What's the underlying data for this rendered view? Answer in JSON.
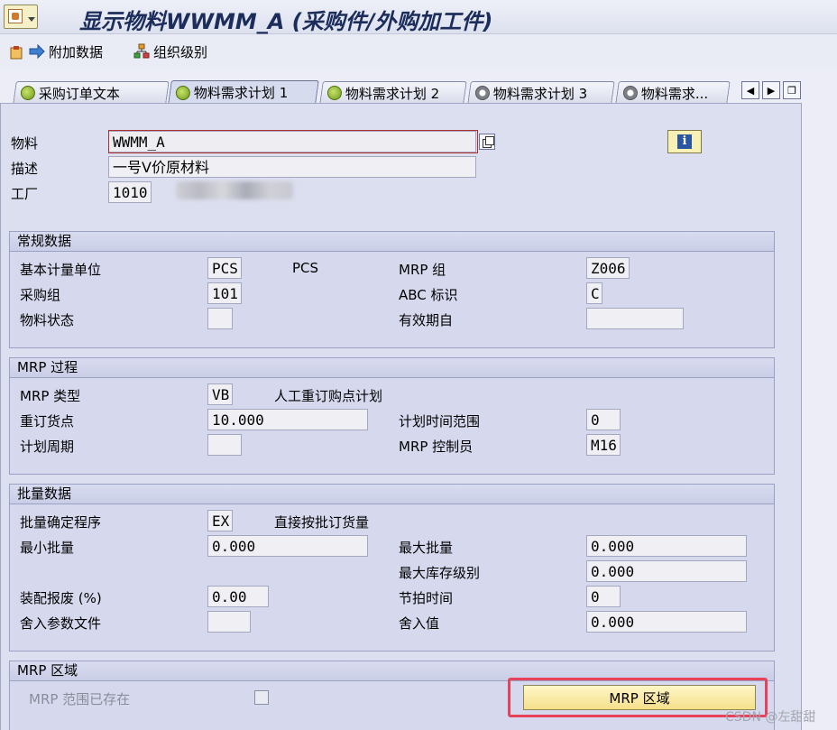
{
  "window": {
    "title": "显示物料WWMM_A (采购件/外购加工件)"
  },
  "toolbar": {
    "additional_data": "附加数据",
    "org_levels": "组织级别"
  },
  "tabs": [
    "采购订单文本",
    "物料需求计划 1",
    "物料需求计划 2",
    "物料需求计划 3",
    "物料需求..."
  ],
  "header": {
    "material_label": "物料",
    "material_value": "WWMM_A",
    "desc_label": "描述",
    "desc_value": "一号V价原材料",
    "plant_label": "工厂",
    "plant_value": "1010"
  },
  "general": {
    "title": "常规数据",
    "base_uom_label": "基本计量单位",
    "base_uom_value": "PCS",
    "base_uom_text": "PCS",
    "mrp_group_label": "MRP 组",
    "mrp_group_value": "Z006",
    "purch_group_label": "采购组",
    "purch_group_value": "101",
    "abc_label": "ABC 标识",
    "abc_value": "C",
    "status_label": "物料状态",
    "status_value": "",
    "valid_from_label": "有效期自",
    "valid_from_value": ""
  },
  "mrp_proc": {
    "title": "MRP 过程",
    "type_label": "MRP 类型",
    "type_value": "VB",
    "type_text": "人工重订购点计划",
    "reorder_label": "重订货点",
    "reorder_value": "10.000",
    "horizon_label": "计划时间范围",
    "horizon_value": "0",
    "cycle_label": "计划周期",
    "cycle_value": "",
    "controller_label": "MRP 控制员",
    "controller_value": "M16"
  },
  "lot": {
    "title": "批量数据",
    "proc_label": "批量确定程序",
    "proc_value": "EX",
    "proc_text": "直接按批订货量",
    "min_label": "最小批量",
    "min_value": "0.000",
    "max_label": "最大批量",
    "max_value": "0.000",
    "maxstock_label": "最大库存级别",
    "maxstock_value": "0.000",
    "scrap_label": "装配报废 (%)",
    "scrap_value": "0.00",
    "takt_label": "节拍时间",
    "takt_value": "0",
    "round_profile_label": "舍入参数文件",
    "round_profile_value": "",
    "round_value_label": "舍入值",
    "round_value_value": "0.000"
  },
  "mrp_area": {
    "title": "MRP 区域",
    "exists_label": "MRP 范围已存在",
    "button_label": "MRP 区域"
  },
  "watermark": "CSDN @左甜甜"
}
